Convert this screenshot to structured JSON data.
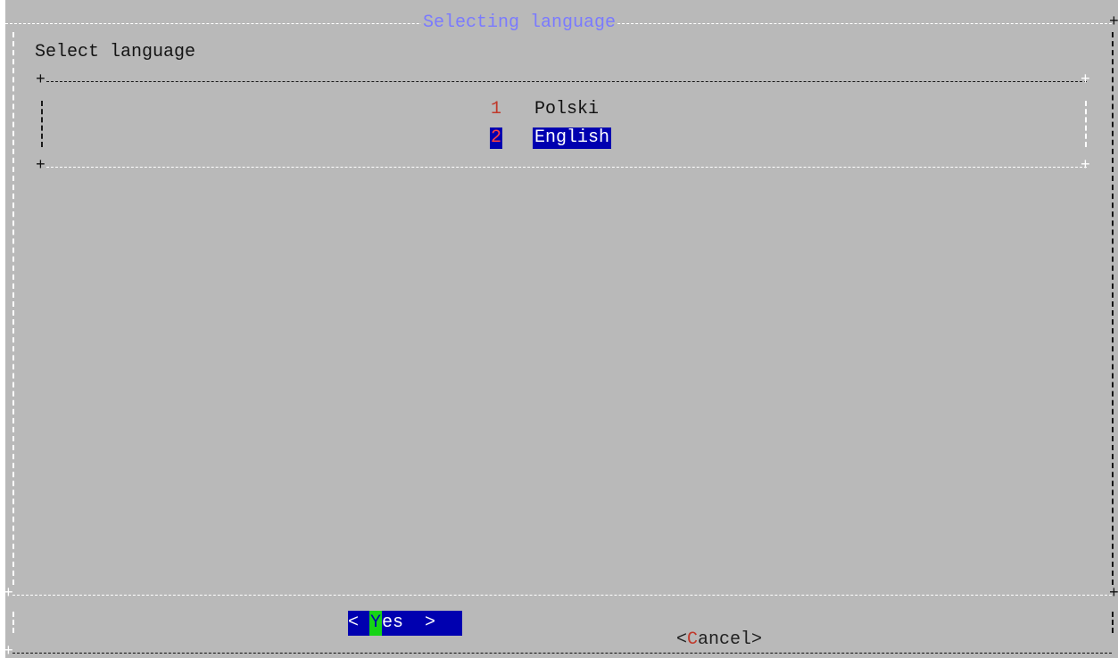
{
  "dialog": {
    "title": "Selecting language",
    "prompt": "Select language",
    "border_color": "#ffffff",
    "inner_border_color": "#1a1a1a",
    "background": "#b9b9b9",
    "title_color": "#7a7aff"
  },
  "menu": {
    "items": [
      {
        "number": "1",
        "label": "Polski",
        "selected": false
      },
      {
        "number": "2",
        "label": "English",
        "selected": true
      }
    ],
    "selection_color": "#0000b0"
  },
  "buttons": {
    "yes": {
      "left": "< ",
      "hotkey": "Y",
      "rest": "es  >"
    },
    "cancel": {
      "left": "<",
      "hotkey": "C",
      "rest": "ancel>"
    }
  }
}
